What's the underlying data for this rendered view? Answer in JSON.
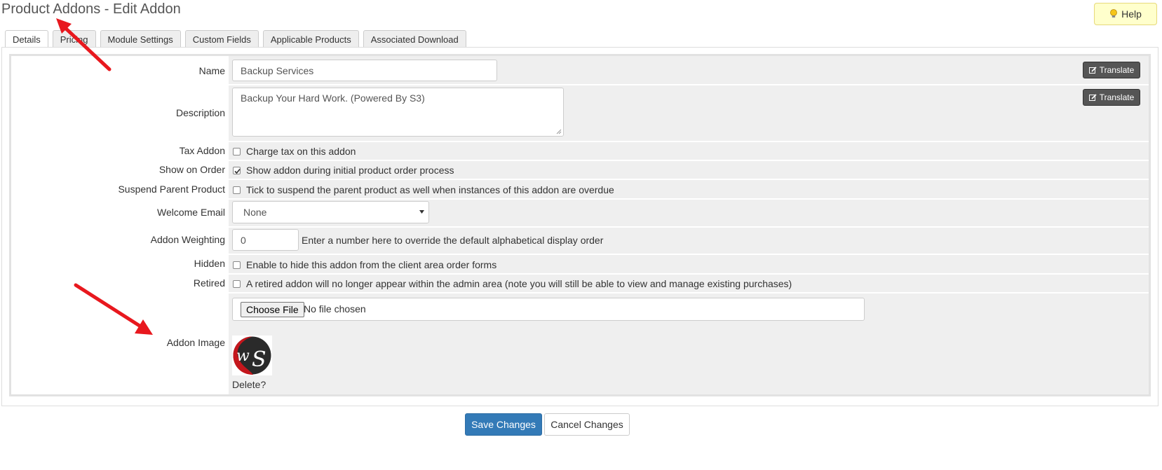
{
  "page": {
    "title": "Product Addons - Edit Addon",
    "help_label": "Help"
  },
  "tabs": [
    {
      "label": "Details",
      "active": true
    },
    {
      "label": "Pricing",
      "active": false
    },
    {
      "label": "Module Settings",
      "active": false
    },
    {
      "label": "Custom Fields",
      "active": false
    },
    {
      "label": "Applicable Products",
      "active": false
    },
    {
      "label": "Associated Download",
      "active": false
    }
  ],
  "form": {
    "name": {
      "label": "Name",
      "value": "Backup Services"
    },
    "description": {
      "label": "Description",
      "value": "Backup Your Hard Work. (Powered By S3)"
    },
    "translate_label": "Translate",
    "tax_addon": {
      "label": "Tax Addon",
      "text": "Charge tax on this addon",
      "checked": false
    },
    "show_on_order": {
      "label": "Show on Order",
      "text": "Show addon during initial product order process",
      "checked": true
    },
    "suspend_parent": {
      "label": "Suspend Parent Product",
      "text": "Tick to suspend the parent product as well when instances of this addon are overdue",
      "checked": false
    },
    "welcome_email": {
      "label": "Welcome Email",
      "selected": "None"
    },
    "weighting": {
      "label": "Addon Weighting",
      "value": "0",
      "help": "Enter a number here to override the default alphabetical display order"
    },
    "hidden": {
      "label": "Hidden",
      "text": "Enable to hide this addon from the client area order forms",
      "checked": false
    },
    "retired": {
      "label": "Retired",
      "text": "A retired addon will no longer appear within the admin area (note you will still be able to view and manage existing purchases)",
      "checked": false
    },
    "addon_image": {
      "label": "Addon Image",
      "choose_label": "Choose File",
      "status": "No file chosen",
      "delete_label": "Delete?"
    }
  },
  "actions": {
    "save_label": "Save Changes",
    "cancel_label": "Cancel Changes"
  },
  "colors": {
    "primary": "#337ab7",
    "annotation_arrow": "#e8181e",
    "help_bg": "#ffffcc",
    "logo_red": "#c4161c"
  },
  "icons": {
    "help": "lightbulb-icon",
    "translate": "edit-icon",
    "checkbox": "checkmark-icon",
    "select": "caret-down-icon"
  }
}
